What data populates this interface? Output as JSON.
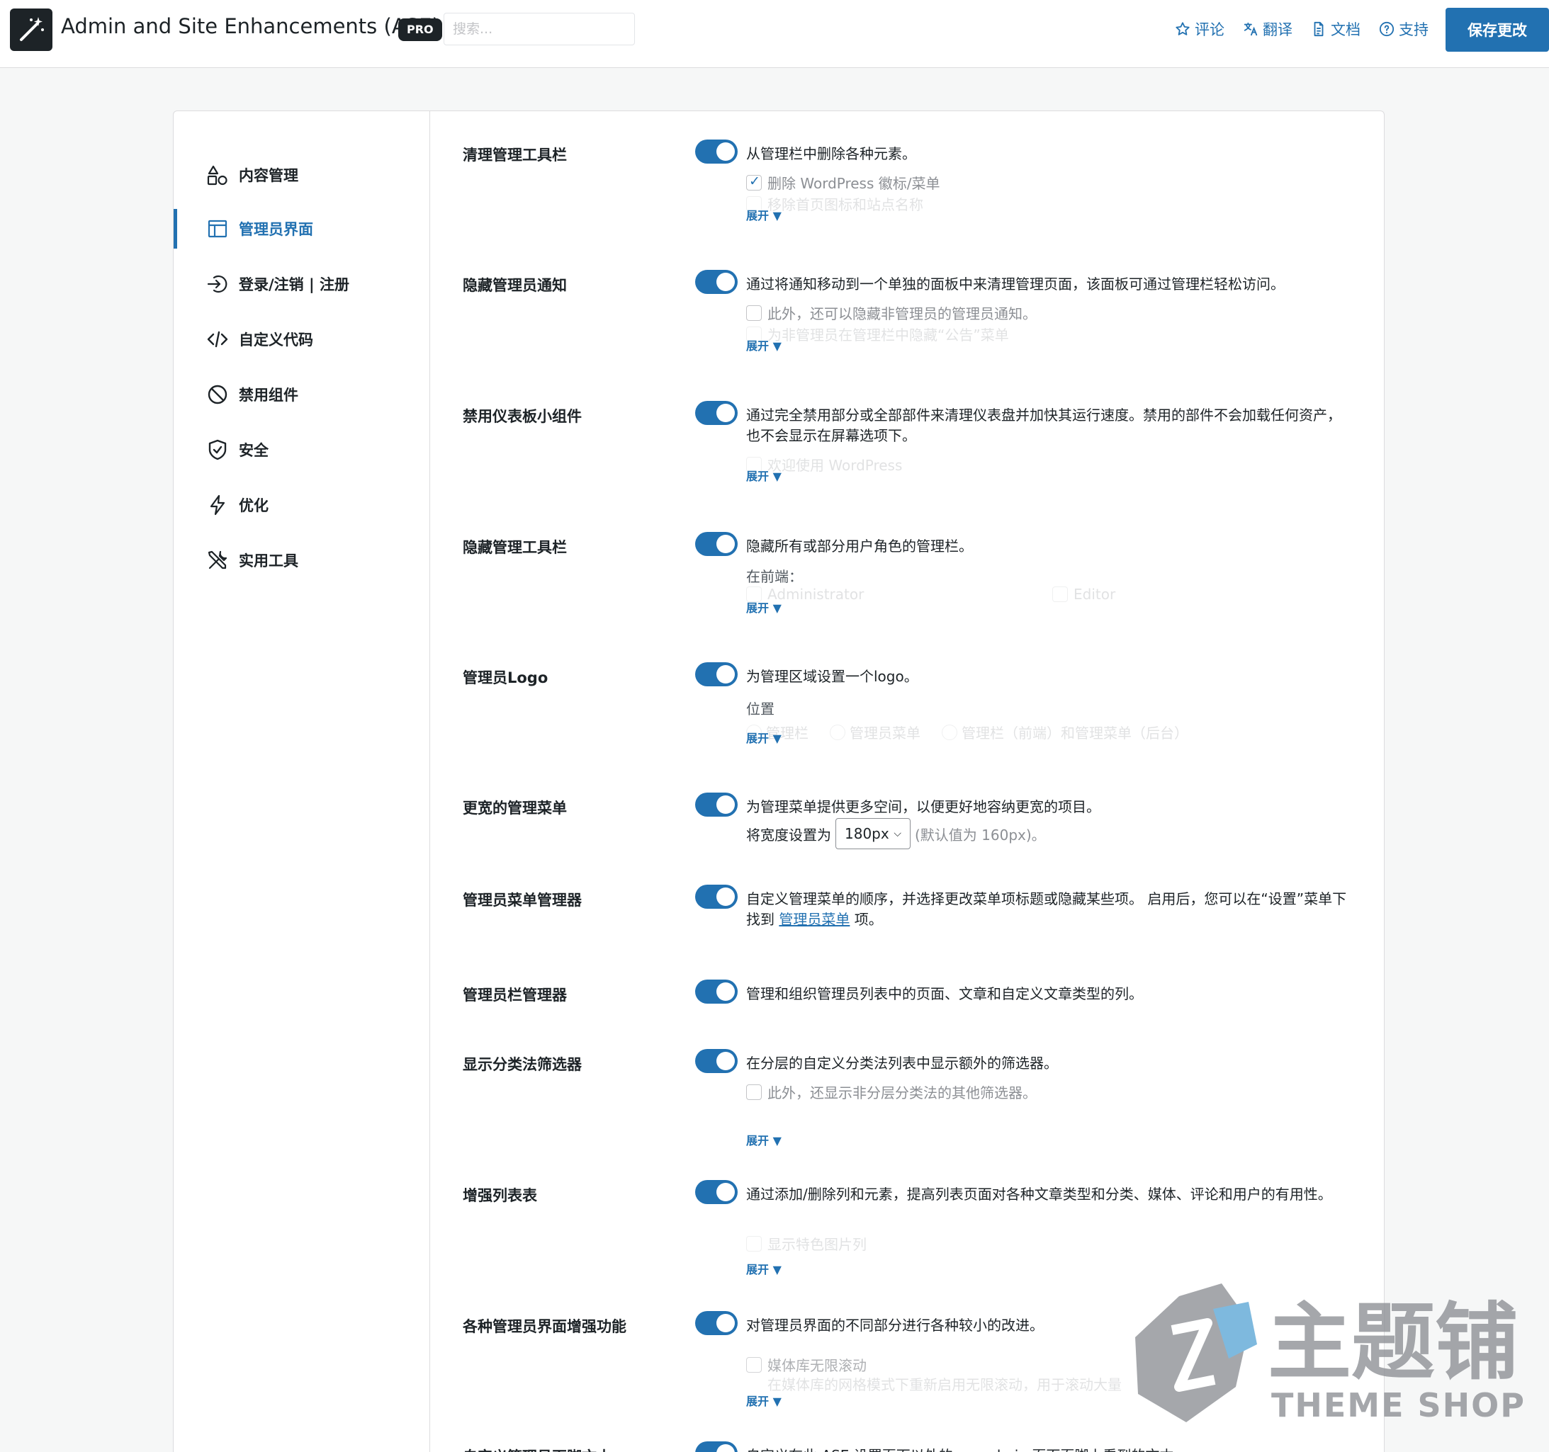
{
  "header": {
    "title": "Admin and Site Enhancements (ASE)",
    "badge": "PRO",
    "search_placeholder": "搜索...",
    "links": [
      {
        "icon": "star-icon",
        "label": "评论"
      },
      {
        "icon": "translate-icon",
        "label": "翻译"
      },
      {
        "icon": "document-icon",
        "label": "文档"
      },
      {
        "icon": "help-icon",
        "label": "支持"
      }
    ],
    "save_label": "保存更改"
  },
  "sidebar": {
    "items": [
      {
        "icon": "content-management-icon",
        "label": "内容管理",
        "active": false
      },
      {
        "icon": "admin-interface-icon",
        "label": "管理员界面",
        "active": true
      },
      {
        "icon": "login-icon",
        "label": "登录/注销 | 注册",
        "active": false
      },
      {
        "icon": "code-icon",
        "label": "自定义代码",
        "active": false
      },
      {
        "icon": "disable-icon",
        "label": "禁用组件",
        "active": false
      },
      {
        "icon": "shield-icon",
        "label": "安全",
        "active": false
      },
      {
        "icon": "lightning-icon",
        "label": "优化",
        "active": false
      },
      {
        "icon": "tools-icon",
        "label": "实用工具",
        "active": false
      }
    ]
  },
  "expand_label": "展开 ▼",
  "settings": [
    {
      "label": "清理管理工具栏",
      "enabled": true,
      "description": "从管理栏中删除各种元素。",
      "options": [
        "删除 WordPress 徽标/菜单",
        "移除首页图标和站点名称"
      ]
    },
    {
      "label": "隐藏管理员通知",
      "enabled": true,
      "description": "通过将通知移动到一个单独的面板中来清理管理页面，该面板可通过管理栏轻松访问。",
      "options": [
        "此外，还可以隐藏非管理员的管理员通知。",
        "为非管理员在管理栏中隐藏“公告”菜单"
      ]
    },
    {
      "label": "禁用仪表板小组件",
      "enabled": true,
      "description": "通过完全禁用部分或全部部件来清理仪表盘并加快其运行速度。禁用的部件不会加载任何资产，也不会显示在屏幕选项下。",
      "options": [
        "欢迎使用 WordPress"
      ]
    },
    {
      "label": "隐藏管理工具栏",
      "enabled": true,
      "description": "隐藏所有或部分用户角色的管理栏。",
      "sub_label": "在前端：",
      "options": [
        "Administrator",
        "Editor"
      ]
    },
    {
      "label": "管理员Logo",
      "enabled": true,
      "description": "为管理区域设置一个logo。",
      "sub_label": "位置",
      "options": [
        "管理栏",
        "管理员菜单",
        "管理栏（前端）和管理菜单（后台）"
      ]
    },
    {
      "label": "更宽的管理菜单",
      "enabled": true,
      "description": "为管理菜单提供更多空间，以便更好地容纳更宽的项目。",
      "width_prefix": "将宽度设置为",
      "width_value": "180px",
      "width_default": "(默认值为 160px)。"
    },
    {
      "label": "管理员菜单管理器",
      "enabled": true,
      "description": "自定义管理菜单的顺序，并选择更改菜单项标题或隐藏某些项。 启用后，您可以在“设置”菜单下找到",
      "link_text": "管理员菜单",
      "description_suffix": " 项。"
    },
    {
      "label": "管理员栏管理器",
      "enabled": true,
      "description": "管理和组织管理员列表中的页面、文章和自定义文章类型的列。"
    },
    {
      "label": "显示分类法筛选器",
      "enabled": true,
      "description": "在分层的自定义分类法列表中显示额外的筛选器。",
      "options": [
        "此外，还显示非分层分类法的其他筛选器。"
      ]
    },
    {
      "label": "增强列表表",
      "enabled": true,
      "description": "通过添加/删除列和元素，提高列表页面对各种文章类型和分类、媒体、评论和用户的有用性。",
      "options": [
        "显示特色图片列"
      ]
    },
    {
      "label": "各种管理员界面增强功能",
      "enabled": true,
      "description": "对管理员界面的不同部分进行各种较小的改进。",
      "options": [
        "媒体库无限滚动",
        "在媒体库的网格模式下重新启用无限滚动，用于滚动大量"
      ]
    },
    {
      "label": "自定义管理员页脚文本",
      "enabled": true,
      "description": "自定义在此 ASE 设置页面以外的 wp-admin 页面页脚上看到的文本"
    }
  ],
  "watermark": {
    "brand": "主题铺",
    "sub": "THEME SHOP"
  }
}
